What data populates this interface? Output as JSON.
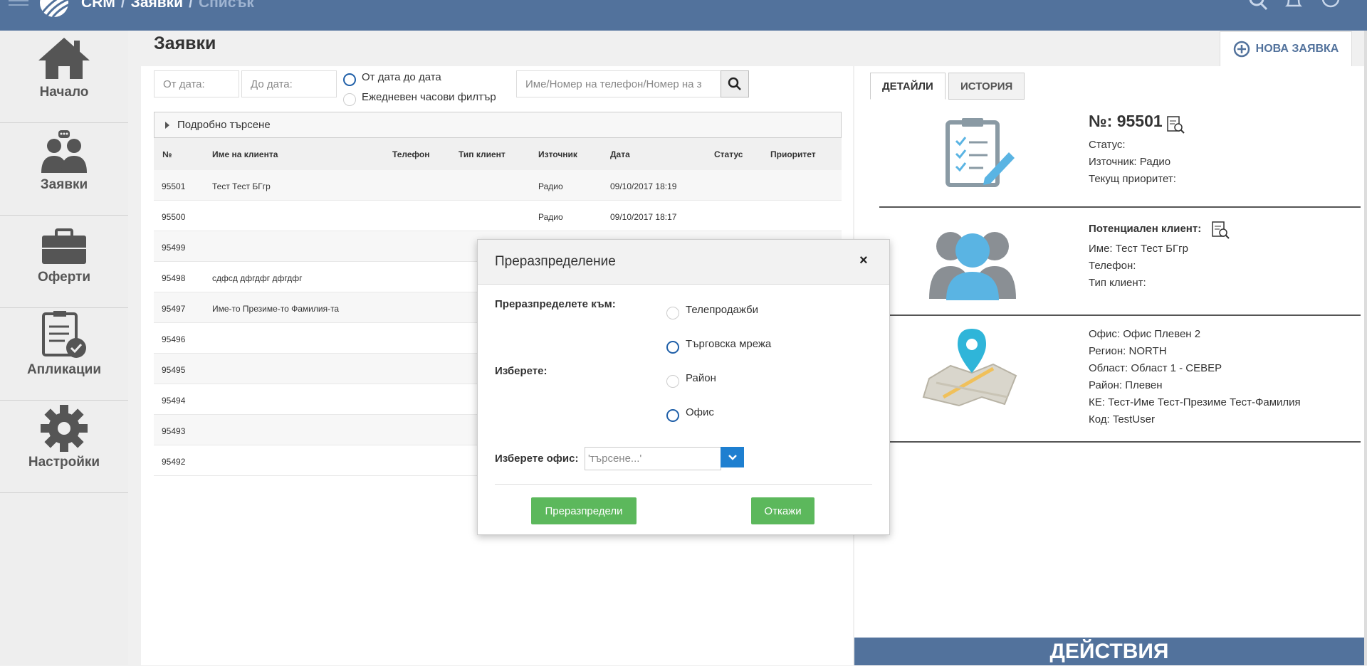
{
  "topbar": {
    "breadcrumb": [
      "CRM",
      "Заявки",
      "Списък"
    ],
    "separator": "/"
  },
  "sidebar": {
    "items": [
      {
        "label": "Начало",
        "icon": "home-icon"
      },
      {
        "label": "Заявки",
        "icon": "people-icon"
      },
      {
        "label": "Оферти",
        "icon": "briefcase-icon"
      },
      {
        "label": "Апликации",
        "icon": "clipboard-check-icon"
      },
      {
        "label": "Настройки",
        "icon": "gear-icon"
      }
    ]
  },
  "page": {
    "title": "Заявки",
    "new_button": "НОВА ЗАЯВКА"
  },
  "filters": {
    "from_date_placeholder": "От дата:",
    "to_date_placeholder": "До дата:",
    "radio_range": "От дата до дата",
    "radio_hourly": "Ежедневен часови филтър",
    "search_placeholder": "Име/Номер на телефон/Номер на з",
    "advanced": "Подробно търсене"
  },
  "table": {
    "headers": [
      "№",
      "Име на клиента",
      "Телефон",
      "Тип клиент",
      "Източник",
      "Дата",
      "Статус",
      "Приоритет"
    ],
    "rows": [
      {
        "no": "95501",
        "name": "Тест Тест БГгр",
        "source": "Радио",
        "date": "09/10/2017 18:19"
      },
      {
        "no": "95500",
        "name": "",
        "source": "Радио",
        "date": "09/10/2017 18:17"
      },
      {
        "no": "95499",
        "name": "",
        "source": "",
        "date": ""
      },
      {
        "no": "95498",
        "name": "сдфсд дфгдфг дфгдфг",
        "source": "",
        "date": ""
      },
      {
        "no": "95497",
        "name": "Име-то Презиме-то Фамилия-та",
        "source": "",
        "date": ""
      },
      {
        "no": "95496",
        "name": "",
        "source": "",
        "date": ""
      },
      {
        "no": "95495",
        "name": "",
        "source": "",
        "date": ""
      },
      {
        "no": "95494",
        "name": "",
        "source": "",
        "date": ""
      },
      {
        "no": "95493",
        "name": "",
        "source": "",
        "date": ""
      },
      {
        "no": "95492",
        "name": "",
        "source": "",
        "date": ""
      }
    ]
  },
  "details": {
    "tabs": [
      "ДЕТАЙЛИ",
      "ИСТОРИЯ"
    ],
    "request_no": "№: 95501",
    "status": "Статус:",
    "source": "Източник: Радио",
    "priority": "Текущ приоритет:",
    "client_title": "Потенциален клиент:",
    "client_name": "Име: Тест Тест БГгр",
    "client_phone": "Телефон:",
    "client_type": "Тип клиент:",
    "office": "Офис: Офис Плевен 2",
    "region": "Регион: NORTH",
    "oblast": "Област: Област 1 - СЕВЕР",
    "rayon": "Район: Плевен",
    "ke": "КЕ: Тест-Име Тест-Презиме Тест-Фамилия",
    "code": "Код: TestUser",
    "actions": "ДЕЙСТВИЯ"
  },
  "modal": {
    "title": "Преразпределение",
    "close": "×",
    "redistribute_to": "Преразпределете към:",
    "choose": "Изберете:",
    "options": [
      "Телепродажби",
      "Търговска мрежа",
      "Район",
      "Офис"
    ],
    "choose_office": "Изберете офис:",
    "office_placeholder": "'търсене...'",
    "submit": "Преразпредели",
    "cancel": "Откажи"
  },
  "colors": {
    "topbar": "#52729c",
    "accent": "#1e7fd0",
    "success": "#5cb85c"
  }
}
